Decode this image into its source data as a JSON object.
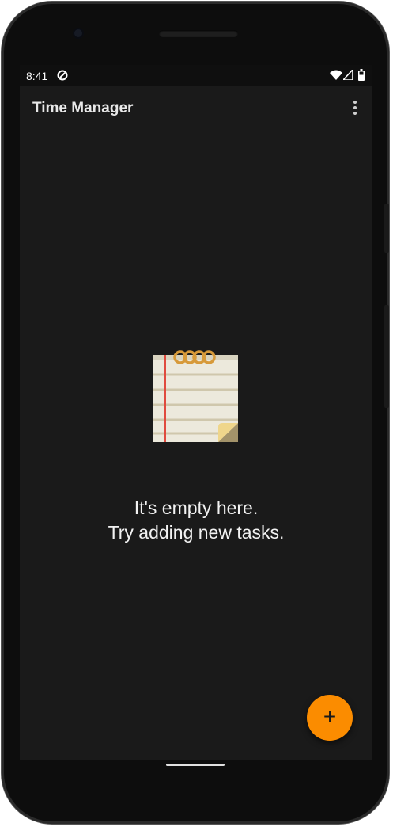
{
  "status_bar": {
    "time": "8:41",
    "icons": [
      "sync-icon",
      "wifi-icon",
      "cellular-signal-icon",
      "battery-icon"
    ]
  },
  "app_bar": {
    "title": "Time Manager",
    "overflow_icon": "more-vert-icon"
  },
  "empty_state": {
    "illustration": "notepad-icon",
    "line1": "It's empty here.",
    "line2": "Try adding new tasks."
  },
  "fab": {
    "icon": "plus-icon",
    "label": "+",
    "color": "#fb8c00"
  },
  "colors": {
    "background": "#1a1a1a",
    "status_bar": "#0f0f0f",
    "accent": "#fb8c00"
  }
}
